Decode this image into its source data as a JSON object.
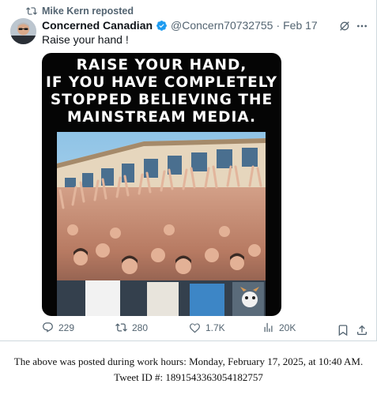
{
  "repost": {
    "label": "Mike Kern reposted",
    "icon": "repost-icon"
  },
  "tweet": {
    "author_name": "Concerned Canadian",
    "verified": true,
    "handle": "@Concern70732755",
    "separator": "·",
    "date": "Feb 17",
    "text": "Raise your hand !"
  },
  "media": {
    "caption_lines": [
      "RAISE YOUR HAND,",
      "IF YOU HAVE COMPLETELY",
      "STOPPED BELIEVING THE",
      "MAINSTREAM MEDIA."
    ]
  },
  "actions": {
    "replies": "229",
    "reposts": "280",
    "likes": "1.7K",
    "views": "20K"
  },
  "footer": {
    "line1": "The above was posted during work hours: Monday, February 17, 2025, at 10:40 AM.",
    "line2": "Tweet ID #: 1891543363054182757"
  },
  "colors": {
    "text": "#0f1419",
    "secondary": "#536471",
    "verified_blue": "#1d9bf0",
    "border": "#cfd9de"
  }
}
